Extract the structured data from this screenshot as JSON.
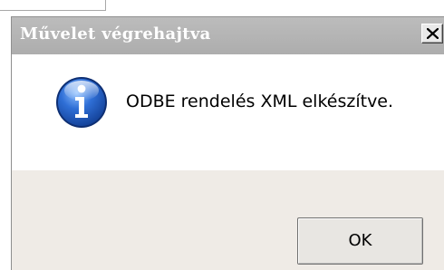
{
  "dialog": {
    "title": "Művelet végrehajtva",
    "message": "ODBE rendelés XML elkészítve.",
    "ok_label": "OK",
    "icon": "info-icon",
    "close_icon": "close-icon"
  },
  "colors": {
    "titlebar": "#b4b4b4",
    "title_text": "#ffffff",
    "footer": "#efebe6",
    "icon_blue": "#1f56b8"
  }
}
